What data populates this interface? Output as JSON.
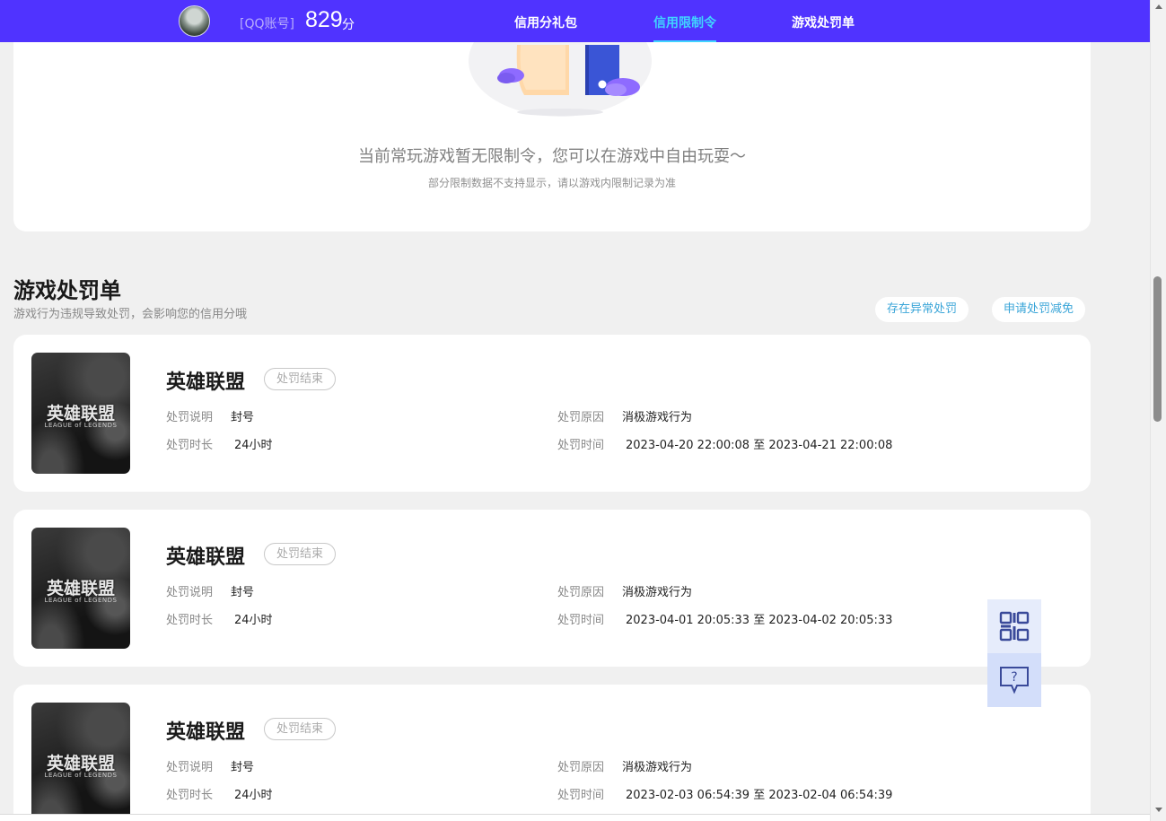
{
  "header": {
    "account_label": "[QQ账号]",
    "score": "829",
    "score_unit": "分",
    "nav": [
      {
        "label": "信用分礼包",
        "active": false
      },
      {
        "label": "信用限制令",
        "active": true
      },
      {
        "label": "游戏处罚单",
        "active": false
      }
    ],
    "accent_color": "#5033ff",
    "active_color": "#40d4ff"
  },
  "restriction": {
    "empty_title": "当前常玩游戏暂无限制令，您可以在游戏中自由玩耍～",
    "empty_subtitle": "部分限制数据不支持显示，请以游戏内限制记录为准"
  },
  "penalties": {
    "title": "游戏处罚单",
    "subtitle": "游戏行为违规导致处罚，会影响您的信用分哦",
    "buttons": {
      "abnormal": "存在异常处罚",
      "appeal": "申请处罚减免"
    },
    "items": [
      {
        "game": "英雄联盟",
        "logo_cn": "英雄联盟",
        "logo_en": "LEAGUE of LEGENDS",
        "status": "处罚结束",
        "desc_label": "处罚说明",
        "desc": "封号",
        "duration_label": "处罚时长",
        "duration": "24小时",
        "reason_label": "处罚原因",
        "reason": "消极游戏行为",
        "time_label": "处罚时间",
        "time": "2023-04-20 22:00:08 至 2023-04-21 22:00:08"
      },
      {
        "game": "英雄联盟",
        "logo_cn": "英雄联盟",
        "logo_en": "LEAGUE of LEGENDS",
        "status": "处罚结束",
        "desc_label": "处罚说明",
        "desc": "封号",
        "duration_label": "处罚时长",
        "duration": "24小时",
        "reason_label": "处罚原因",
        "reason": "消极游戏行为",
        "time_label": "处罚时间",
        "time": "2023-04-01 20:05:33 至 2023-04-02 20:05:33"
      },
      {
        "game": "英雄联盟",
        "logo_cn": "英雄联盟",
        "logo_en": "LEAGUE of LEGENDS",
        "status": "处罚结束",
        "desc_label": "处罚说明",
        "desc": "封号",
        "duration_label": "处罚时长",
        "duration": "24小时",
        "reason_label": "处罚原因",
        "reason": "消极游戏行为",
        "time_label": "处罚时间",
        "time": "2023-02-03 06:54:39 至 2023-02-04 06:54:39"
      }
    ]
  },
  "floating": {
    "qr_icon": "qr-code-icon",
    "help_icon": "help-chat-icon",
    "help_symbol": "?"
  }
}
